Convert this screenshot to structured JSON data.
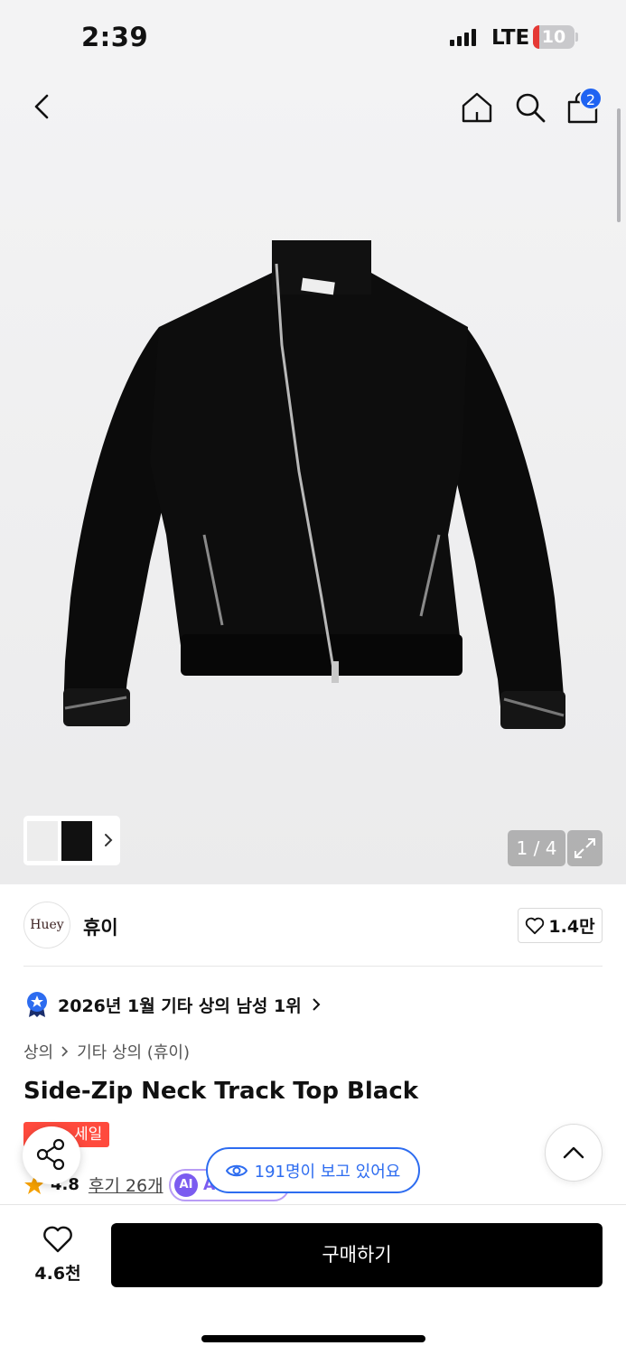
{
  "status_bar": {
    "time": "2:39",
    "network": "LTE",
    "battery": "10"
  },
  "header": {
    "cart_count": "2"
  },
  "gallery": {
    "pager": "1 / 4"
  },
  "brand": {
    "logo_text": "Huey",
    "name": "휴이",
    "likes": "1.4만"
  },
  "ranking": {
    "text": "2026년 1월 기타 상의 남성 1위"
  },
  "breadcrumb": {
    "level1": "상의",
    "level2": "기타 상의 (휴이)"
  },
  "product": {
    "title": "Side-Zip Neck Track Top Black",
    "sale_label": "세일",
    "rating": "4.8",
    "reviews": "후기 26개",
    "ai_badge_icon": "AI",
    "ai_badge_label": "A"
  },
  "viewers": {
    "text": "191명이 보고 있어요"
  },
  "bottom_bar": {
    "wish_count": "4.6천",
    "buy_label": "구매하기"
  },
  "colors": {
    "accent_blue": "#1f63f2",
    "sale_red": "#ff4a3d",
    "ai_purple": "#7b5cf0",
    "buy_black": "#000000"
  }
}
